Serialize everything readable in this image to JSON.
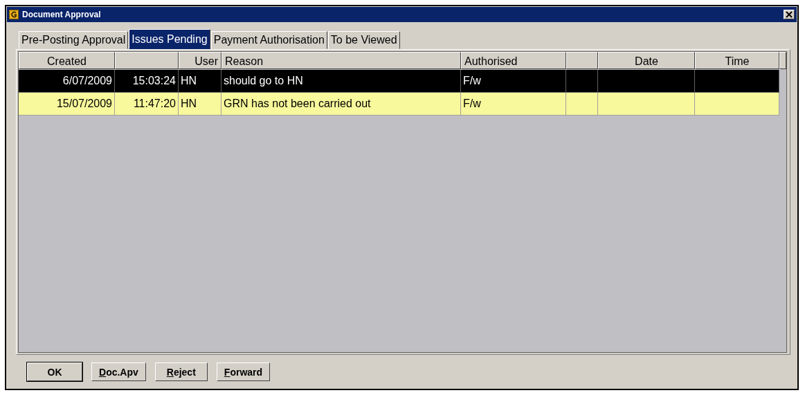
{
  "window": {
    "title": "Document Approval"
  },
  "tabs": [
    {
      "label": "Pre-Posting Approval",
      "selected": false
    },
    {
      "label": "Issues Pending",
      "selected": true
    },
    {
      "label": "Payment Authorisation",
      "selected": false
    },
    {
      "label": "To be Viewed",
      "selected": false
    }
  ],
  "table": {
    "columns": [
      {
        "label": "Created"
      },
      {},
      {
        "label": "User"
      },
      {
        "label": "Reason"
      },
      {
        "label": "Authorised"
      },
      {},
      {
        "label": "Date"
      },
      {
        "label": "Time"
      }
    ],
    "rows": [
      {
        "selected": true,
        "cells": [
          "6/07/2009",
          "15:03:24",
          "HN",
          "should go to HN",
          "F/w"
        ]
      },
      {
        "selected": false,
        "cells": [
          "15/07/2009",
          "11:47:20",
          "HN",
          "GRN has not been carried out",
          "F/w"
        ]
      }
    ]
  },
  "buttons": [
    {
      "label": "OK",
      "default": true
    },
    {
      "label": "Doc.Apv",
      "default": false,
      "underline_first": true
    },
    {
      "label": "Reject",
      "default": false,
      "underline_first": true
    },
    {
      "label": "Forward",
      "default": false,
      "underline_first": true
    }
  ]
}
